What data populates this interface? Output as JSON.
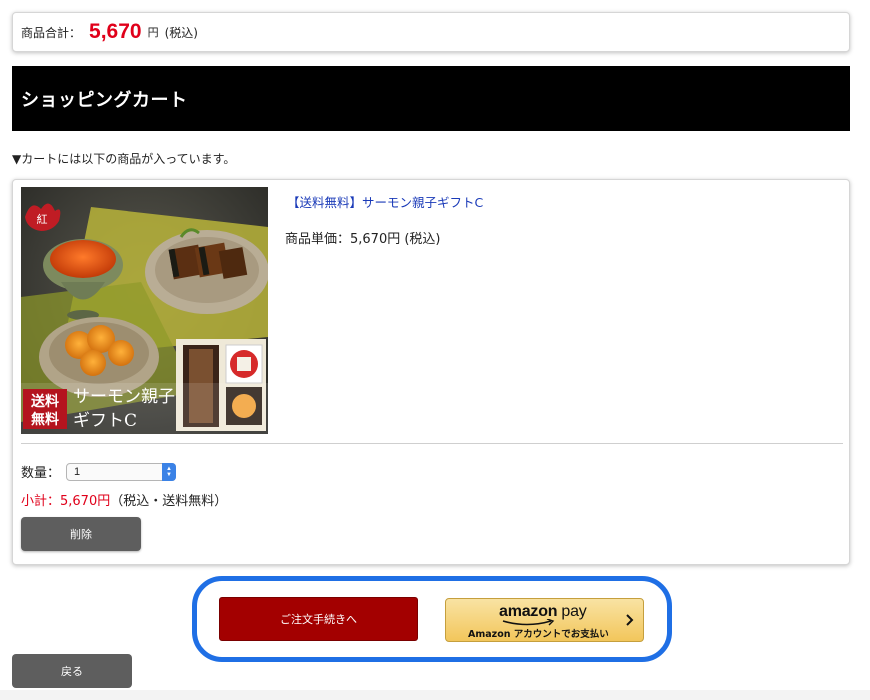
{
  "summary": {
    "label": "商品合計：",
    "amount": "5,670",
    "currency": "円",
    "tax_note": "(税込)"
  },
  "cart": {
    "title": "ショッピングカート",
    "note": "▼カートには以下の商品が入っています。"
  },
  "item": {
    "name": "【送料無料】サーモン親子ギフトC",
    "price": "商品単価：5,670円 (税込)",
    "image_caption_line1": "サーモン親子",
    "image_caption_line2": "ギフトC",
    "image_badge_line1": "送料",
    "image_badge_line2": "無料",
    "quantity_label": "数量：",
    "quantity_value": "1",
    "subtotal_label": "小計：5,670円",
    "subtotal_note": "（税込・送料無料）",
    "delete_label": "削除"
  },
  "checkout": {
    "order_label": "ご注文手続きへ",
    "amazon_brand": "amazon",
    "amazon_pay": "pay",
    "amazon_sub": "Amazon アカウントでお支払い"
  },
  "nav": {
    "back_label": "戻る"
  },
  "colors": {
    "price_red": "#e0001a",
    "header_bg": "#000000",
    "link_blue": "#1a3ab8",
    "order_button": "#a30000",
    "gray_button": "#5e5e5e",
    "highlight_ring": "#1f6fe5"
  },
  "icons": {
    "stepper": "up-down-arrows-icon",
    "amazon_arrow": "chevron-right-icon",
    "amazon_smile": "amazon-smile-icon"
  }
}
